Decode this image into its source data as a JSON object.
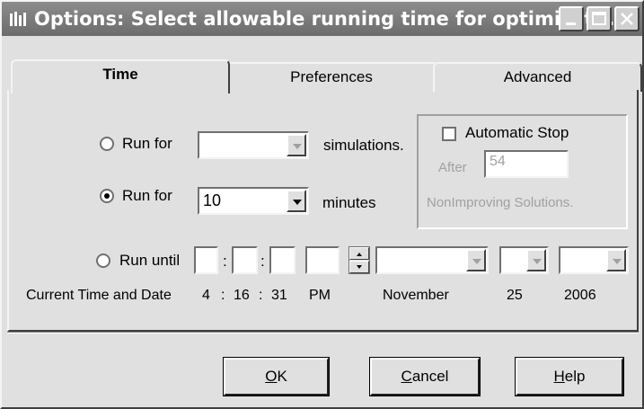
{
  "window": {
    "title": "Options: Select allowable running time for optimizat...",
    "title_icon": "app-icon",
    "controls": [
      "minimize-icon",
      "maximize-icon",
      "close-icon"
    ]
  },
  "tabs": [
    {
      "label": "Time",
      "active": true
    },
    {
      "label": "Preferences",
      "active": false
    },
    {
      "label": "Advanced",
      "active": false
    }
  ],
  "run_simulations": {
    "label": "Run for",
    "value": "",
    "suffix": "simulations.",
    "selected": false
  },
  "run_minutes": {
    "label": "Run for",
    "value": "10",
    "suffix": "minutes",
    "selected": true
  },
  "auto_stop": {
    "label": "Automatic Stop",
    "checked": false,
    "after_label": "After",
    "after_value": "54",
    "solutions_label": "NonImproving Solutions."
  },
  "run_until": {
    "label": "Run until",
    "colon": ":",
    "hour": "",
    "minute": "",
    "second": "",
    "ampm": "",
    "month": "",
    "day": "",
    "year": "",
    "selected": false
  },
  "current": {
    "label": "Current Time and Date",
    "hour": "4",
    "minute": "16",
    "second": "31",
    "sep": ":",
    "ampm": "PM",
    "month": "November",
    "day": "25",
    "year": "2006"
  },
  "buttons": {
    "ok": {
      "mnemonic": "O",
      "rest": "K"
    },
    "cancel": {
      "mnemonic": "C",
      "rest": "ancel"
    },
    "help": {
      "mnemonic": "H",
      "rest": "elp"
    }
  },
  "colors": {
    "titlebar": "#7c7c7c",
    "face": "#e0e0e0",
    "disabled_text": "#a0a0a0"
  }
}
